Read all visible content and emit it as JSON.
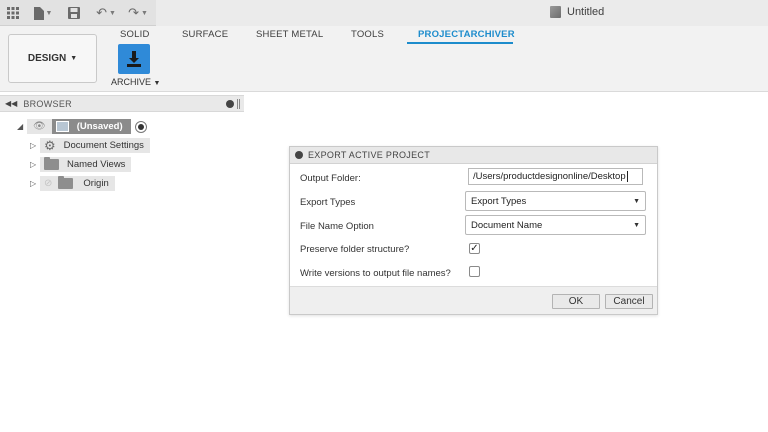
{
  "app": {
    "document_title": "Untitled"
  },
  "toolbar": {
    "icons": [
      "grid-icon",
      "file-icon",
      "save-icon",
      "undo-icon",
      "redo-icon"
    ]
  },
  "ribbon": {
    "tabs": [
      "SOLID",
      "SURFACE",
      "SHEET METAL",
      "TOOLS",
      "PROJECTARCHIVER"
    ],
    "active_tab": "PROJECTARCHIVER",
    "workspace_label": "DESIGN",
    "archive_label": "ARCHIVE",
    "accent_color": "#1d8ccc"
  },
  "browser": {
    "title": "BROWSER",
    "root_label": "(Unsaved)",
    "items": [
      {
        "label": "Document Settings",
        "icon": "gear-icon"
      },
      {
        "label": "Named Views",
        "icon": "folder-icon"
      },
      {
        "label": "Origin",
        "icon": "folder-icon"
      }
    ]
  },
  "dialog": {
    "title": "EXPORT ACTIVE PROJECT",
    "output_folder_label": "Output Folder:",
    "output_folder_value": "/Users/productdesignonline/Desktop",
    "export_types_label": "Export Types",
    "export_types_value": "Export Types",
    "file_name_option_label": "File Name Option",
    "file_name_option_value": "Document Name",
    "preserve_label": "Preserve folder structure?",
    "preserve_checked": true,
    "write_versions_label": "Write versions to output file names?",
    "write_versions_checked": false,
    "ok_label": "OK",
    "cancel_label": "Cancel"
  }
}
